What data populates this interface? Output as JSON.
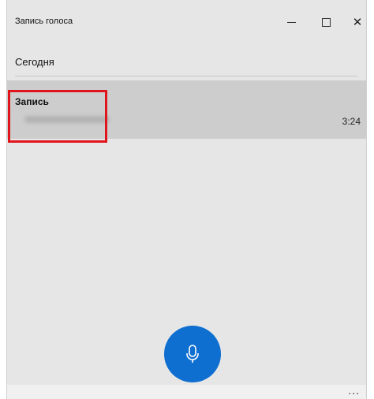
{
  "window": {
    "title": "Запись голоса",
    "minimize_icon": "minimize-icon",
    "maximize_icon": "maximize-icon",
    "close_icon": "close-icon",
    "close_glyph": "✕"
  },
  "list": {
    "section_title": "Сегодня",
    "recordings": [
      {
        "name": "Запись",
        "duration": "3:24"
      }
    ]
  },
  "record_button": {
    "icon": "microphone-icon"
  },
  "bottom_bar": {
    "more_label": "..."
  },
  "colors": {
    "accent": "#0f6fd0",
    "highlight": "#e0141b",
    "background": "#e6e6e6",
    "selected_row": "#cdcdcd"
  }
}
